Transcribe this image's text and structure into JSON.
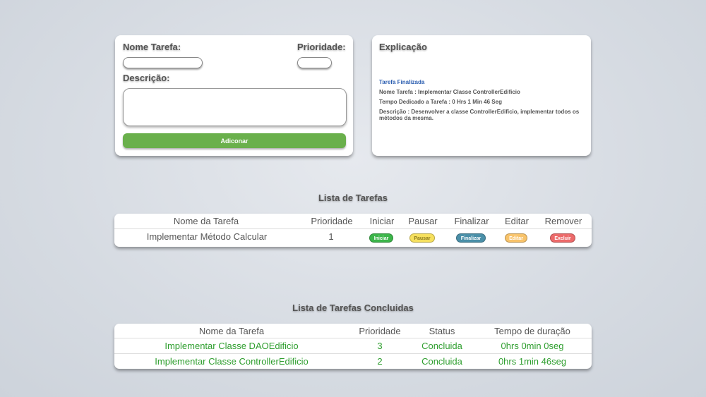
{
  "form": {
    "name_label": "Nome Tarefa:",
    "priority_label": "Prioridade:",
    "description_label": "Descrição:",
    "name_value": "",
    "priority_value": "",
    "description_value": "",
    "add_button": "Adiconar"
  },
  "explanation": {
    "title": "Explicação",
    "status": "Tarefa Finalizada",
    "task_name": "Nome Tarefa : Implementar Classe ControllerEdificio",
    "time_spent": "Tempo Dedicado a Tarefa : 0 Hrs 1 Min 46 Seg",
    "description": "Descrição : Desenvolver a classe ControllerEdificio, implementar todos os métodos da mesma."
  },
  "tasks": {
    "title": "Lista de Tarefas",
    "headers": [
      "Nome da Tarefa",
      "Prioridade",
      "Iniciar",
      "Pausar",
      "Finalizar",
      "Editar",
      "Remover"
    ],
    "rows": [
      {
        "name": "Implementar Método Calcular",
        "priority": "1",
        "start": "Iniciar",
        "pause": "Pausar",
        "finish": "Finalizar",
        "edit": "Editar",
        "remove": "Excluir"
      }
    ]
  },
  "completed": {
    "title": "Lista de Tarefas Concluidas",
    "headers": [
      "Nome da Tarefa",
      "Prioridade",
      "Status",
      "Tempo de duração"
    ],
    "rows": [
      {
        "name": "Implementar Classe DAOEdificio",
        "priority": "3",
        "status": "Concluida",
        "duration": "0hrs 0min 0seg"
      },
      {
        "name": "Implementar Classe ControllerEdificio",
        "priority": "2",
        "status": "Concluida",
        "duration": "0hrs 1min 46seg"
      }
    ]
  },
  "colors": {
    "add": "#6ab04c",
    "start": "#3cb54a",
    "pause": "#f6e05e",
    "finish": "#4a8fa8",
    "edit": "#f8c36a",
    "remove": "#ec6a6a",
    "done_text": "#2e9e2e",
    "status_link": "#2a5db0"
  }
}
